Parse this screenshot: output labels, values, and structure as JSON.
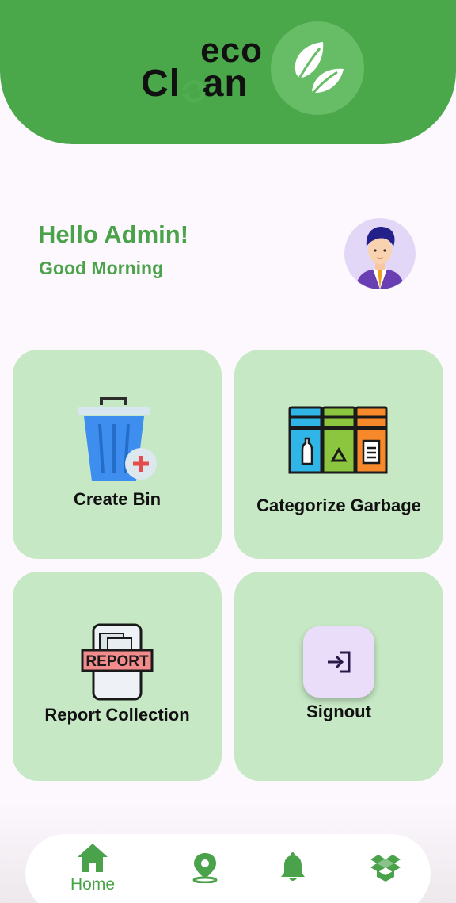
{
  "brand": {
    "logo_top": "eco",
    "logo_bottom": "Clean",
    "logo_bottom_left": "Cl",
    "logo_bottom_right": "an",
    "logo_icon": "leaf-icon",
    "accent_color": "#4aa84a"
  },
  "greeting": {
    "title": "Hello Admin!",
    "subtitle": "Good Morning"
  },
  "cards": [
    {
      "label": "Create Bin",
      "icon": "trash-bin-add-icon"
    },
    {
      "label": "Categorize Garbage",
      "icon": "sorting-bins-icon"
    },
    {
      "label": "Report Collection",
      "icon": "report-document-icon",
      "icon_text": "REPORT"
    },
    {
      "label": "Signout",
      "icon": "signout-icon"
    }
  ],
  "bottom_nav": {
    "items": [
      {
        "label": "Home",
        "icon": "home-icon",
        "active": true
      },
      {
        "label": "",
        "icon": "map-pin-icon"
      },
      {
        "label": "",
        "icon": "bell-icon"
      },
      {
        "label": "",
        "icon": "box-icon"
      }
    ]
  }
}
